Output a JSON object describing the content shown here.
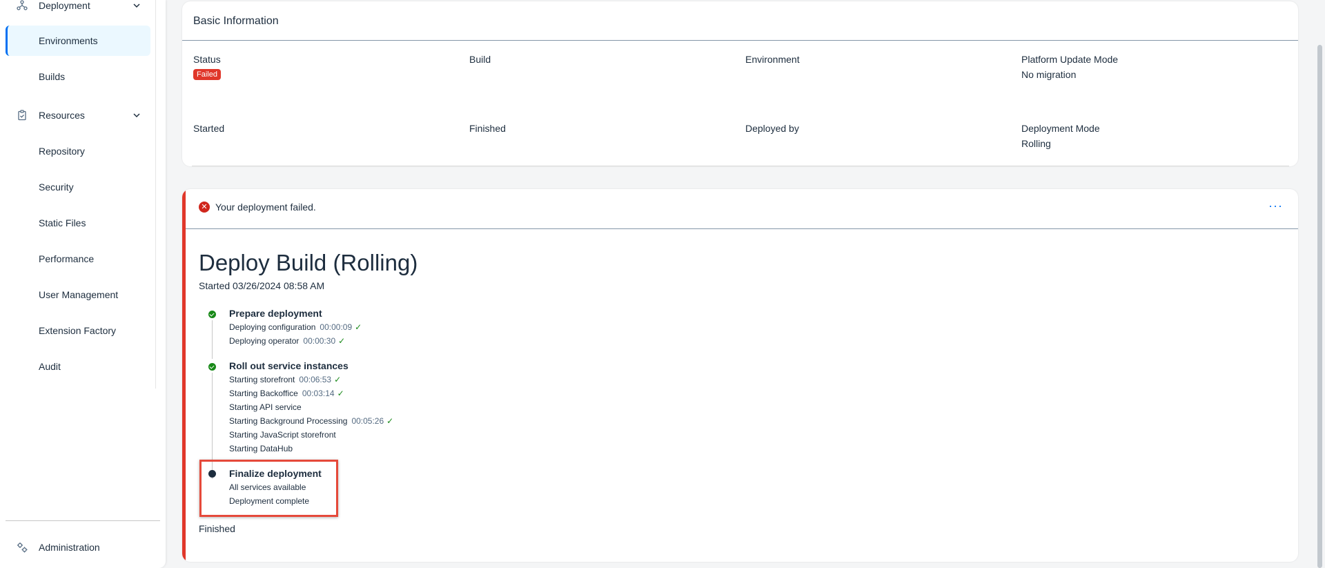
{
  "sidebar": {
    "groups": [
      {
        "label": "Deployment",
        "icon": "deployment-icon"
      },
      {
        "label": "Resources",
        "icon": "clipboard-icon"
      }
    ],
    "deployment_items": [
      "Environments",
      "Builds"
    ],
    "resources_items": [
      "Repository",
      "Security",
      "Static Files",
      "Performance",
      "User Management",
      "Extension Factory",
      "Audit"
    ],
    "bottom_item": "Administration"
  },
  "basic_info": {
    "title": "Basic Information",
    "fields": {
      "status_label": "Status",
      "status_value": "Failed",
      "build_label": "Build",
      "environment_label": "Environment",
      "platform_label": "Platform Update Mode",
      "platform_value": "No migration",
      "started_label": "Started",
      "finished_label": "Finished",
      "deployed_by_label": "Deployed by",
      "mode_label": "Deployment Mode",
      "mode_value": "Rolling"
    }
  },
  "deployment": {
    "message": "Your deployment failed.",
    "more_label": "···",
    "title": "Deploy Build (Rolling)",
    "started": "Started 03/26/2024 08:58 AM",
    "steps": [
      {
        "title": "Prepare deployment",
        "subs": [
          {
            "label": "Deploying configuration",
            "time": "00:00:09",
            "done": "✓"
          },
          {
            "label": "Deploying operator",
            "time": "00:00:30",
            "done": "✓"
          }
        ]
      },
      {
        "title": "Roll out service instances",
        "subs": [
          {
            "label": "Starting storefront",
            "time": "00:06:53",
            "done": "✓"
          },
          {
            "label": "Starting Backoffice",
            "time": "00:03:14",
            "done": "✓"
          },
          {
            "label": "Starting API service",
            "time": "",
            "done": ""
          },
          {
            "label": "Starting Background Processing",
            "time": "00:05:26",
            "done": "✓"
          },
          {
            "label": "Starting JavaScript storefront",
            "time": "",
            "done": ""
          },
          {
            "label": "Starting DataHub",
            "time": "",
            "done": ""
          }
        ]
      },
      {
        "title": "Finalize deployment",
        "subs": [
          {
            "label": "All services available",
            "time": "",
            "done": ""
          },
          {
            "label": "Deployment complete",
            "time": "",
            "done": ""
          }
        ]
      }
    ],
    "finished": "Finished"
  },
  "colors": {
    "accent": "#0070f2",
    "error": "#e0372a",
    "success": "#188918"
  }
}
